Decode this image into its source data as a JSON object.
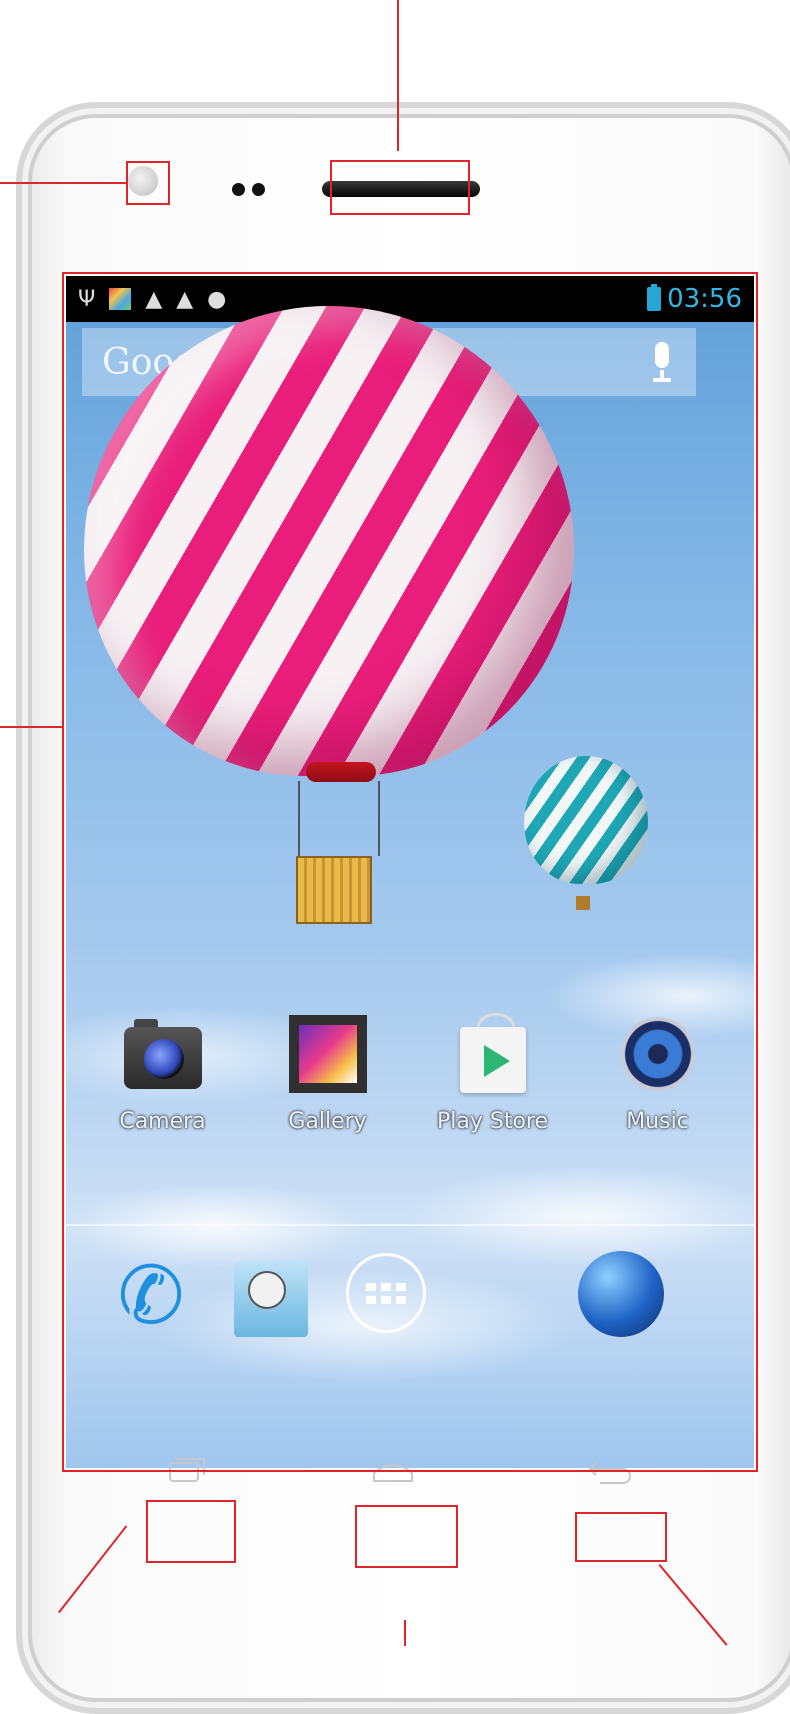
{
  "status_bar": {
    "icons": [
      "usb-icon",
      "gallery-notification-icon",
      "warning-icon",
      "warning-icon",
      "android-debug-icon"
    ],
    "battery": "battery-charging-icon",
    "time": "03:56"
  },
  "search": {
    "logo_text": "Goog",
    "mic": "mic-icon"
  },
  "apps": [
    {
      "label": "Camera",
      "icon": "camera-icon"
    },
    {
      "label": "Gallery",
      "icon": "gallery-icon"
    },
    {
      "label": "Play Store",
      "icon": "play-store-icon"
    },
    {
      "label": "Music",
      "icon": "music-icon"
    }
  ],
  "dock": [
    {
      "icon": "phone-icon"
    },
    {
      "icon": "contacts-icon"
    },
    {
      "icon": "all-apps-icon"
    },
    {
      "icon": "browser-icon"
    }
  ],
  "nav_keys": [
    "recent-apps-key",
    "home-key",
    "back-key"
  ],
  "colors": {
    "annotation": "#e0242b",
    "status_time": "#33b5e5",
    "balloon_stripe": "#e91e7a"
  }
}
